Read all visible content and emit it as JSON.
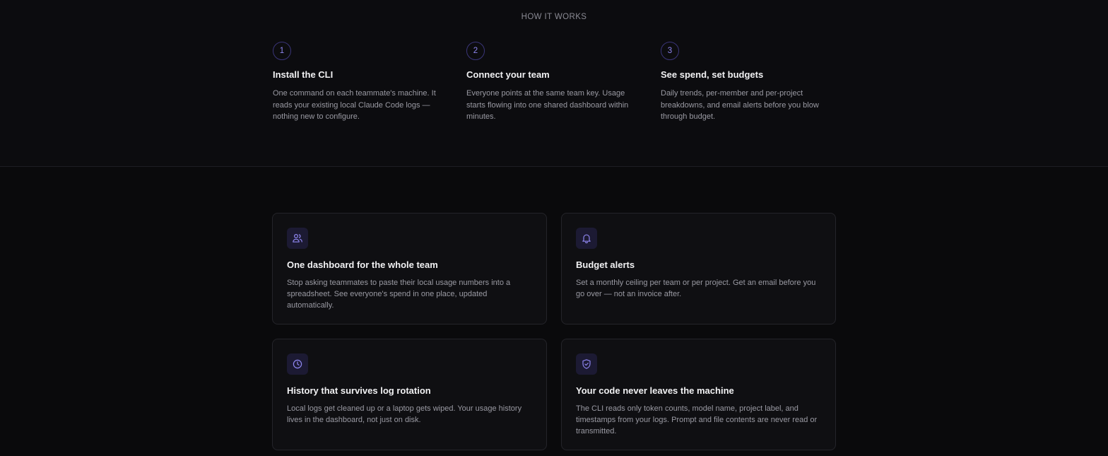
{
  "how_it_works": {
    "eyebrow": "HOW IT WORKS",
    "steps": [
      {
        "number": "1",
        "title": "Install the CLI",
        "description": "One command on each teammate's machine. It reads your existing local Claude Code logs — nothing new to configure."
      },
      {
        "number": "2",
        "title": "Connect your team",
        "description": "Everyone points at the same team key. Usage starts flowing into one shared dashboard within minutes."
      },
      {
        "number": "3",
        "title": "See spend, set budgets",
        "description": "Daily trends, per-member and per-project breakdowns, and email alerts before you blow through budget."
      }
    ]
  },
  "features": [
    {
      "icon": "users-icon",
      "title": "One dashboard for the whole team",
      "description": "Stop asking teammates to paste their local usage numbers into a spreadsheet. See everyone's spend in one place, updated automatically."
    },
    {
      "icon": "bell-icon",
      "title": "Budget alerts",
      "description": "Set a monthly ceiling per team or per project. Get an email before you go over — not an invoice after."
    },
    {
      "icon": "clock-icon",
      "title": "History that survives log rotation",
      "description": "Local logs get cleaned up or a laptop gets wiped. Your usage history lives in the dashboard, not just on disk."
    },
    {
      "icon": "shield-check-icon",
      "title": "Your code never leaves the machine",
      "description": "The CLI reads only token counts, model name, project label, and timestamps from your logs. Prompt and file contents are never read or transmitted."
    }
  ],
  "colors": {
    "accent": "#8f86f0",
    "background": "#0a0a0c",
    "card": "#0f0f12"
  }
}
